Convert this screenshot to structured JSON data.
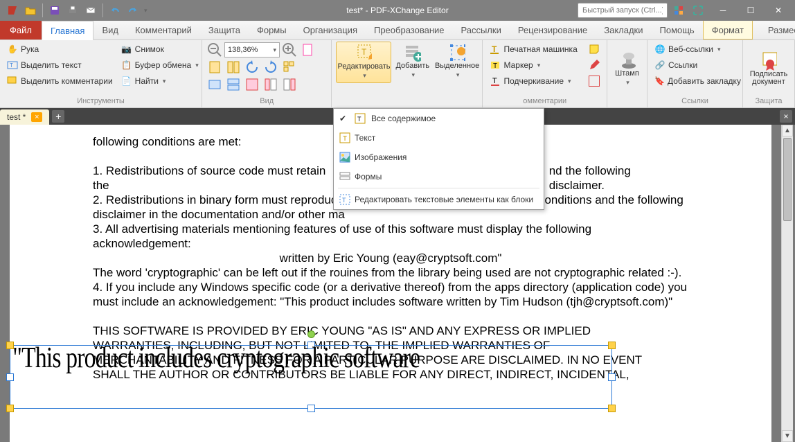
{
  "titlebar": {
    "title": "test* - PDF-XChange Editor",
    "quick_launch_placeholder": "Быстрый запуск (Ctrl...)"
  },
  "tabs": {
    "file": "Файл",
    "items": [
      "Главная",
      "Вид",
      "Комментарий",
      "Защита",
      "Формы",
      "Организация",
      "Преобразование",
      "Рассылки",
      "Рецензирование",
      "Закладки",
      "Помощь"
    ],
    "right": [
      "Формат",
      "Разместить"
    ]
  },
  "ribbon": {
    "tools": {
      "hand": "Рука",
      "select_text": "Выделить текст",
      "select_comments": "Выделить комментарии",
      "snapshot": "Снимок",
      "clipboard": "Буфер обмена",
      "find": "Найти",
      "label": "Инструменты"
    },
    "view": {
      "zoom": "138,36%",
      "label": "Вид"
    },
    "edit": {
      "edit": "Редактировать",
      "add": "Добавить",
      "selected": "Выделенное"
    },
    "comments": {
      "typewriter": "Печатная машинка",
      "marker": "Маркер",
      "underline": "Подчеркивание",
      "label": "омментарии"
    },
    "stamp": {
      "stamp": "Штамп"
    },
    "links": {
      "weblinks": "Веб-ссылки",
      "links": "Ссылки",
      "bookmark": "Добавить закладку",
      "label": "Ссылки"
    },
    "sign": {
      "sign": "Подписать\nдокумент",
      "label": "Защита"
    }
  },
  "dropdown": {
    "all": "Все содержимое",
    "text": "Текст",
    "images": "Изображения",
    "forms": "Формы",
    "edit_blocks": "Редактировать текстовые элементы как блоки"
  },
  "doctab": {
    "name": "test *"
  },
  "document": {
    "line1": "following conditions are met:",
    "line2": "1. Redistributions of source code must retain the",
    "line2b": "nd the following disclaimer.",
    "line3": " 2. Redistributions in binary form must reproduc",
    "line3b": "onditions and the following",
    "line4": "disclaimer in the documentation and/or other ma",
    "line5": " 3. All advertising materials mentioning features of use of this software must display the following acknowledgement:",
    "line6": "written by Eric Young (eay@cryptsoft.com\"",
    "line7": "The word 'cryptographic' can be left out if the rouines from the library  being used are not cryptographic related :-).",
    "line8": " 4. If you include any Windows specific code (or a derivative thereof) from  the apps directory (application code) you",
    "line9": "must include an acknowledgement:  \"This product includes software written by Tim Hudson (tjh@cryptsoft.com)\"",
    "line10": "THIS SOFTWARE IS PROVIDED BY ERIC YOUNG \"AS IS\" AND ANY EXPRESS OR IMPLIED",
    "line11": "WARRANTIES, INCLUDING, BUT NOT LIMITED TO, THE IMPLIED WARRANTIES OF",
    "line12": "MERCHANTABILITY AND FITNESS FOR A PARTICULAR PURPOSE ARE DISCLAIMED.  IN NO EVENT",
    "line13": "SHALL THE AUTHOR OR CONTRIBUTORS BE LIABLE FOR ANY DIRECT, INDIRECT, INCIDENTAL,",
    "selected": "\"This product includes cryptographic software"
  }
}
